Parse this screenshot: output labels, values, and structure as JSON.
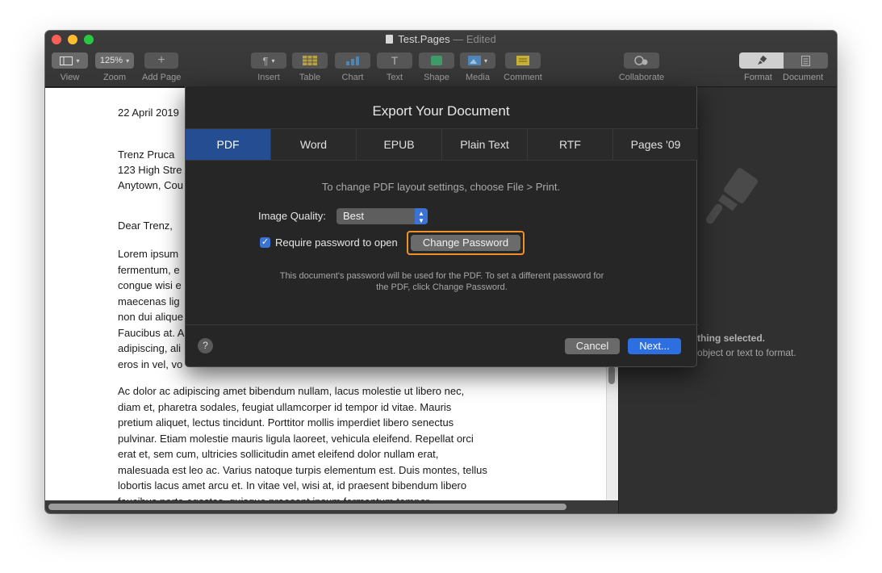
{
  "window": {
    "title": "Test.Pages",
    "status": "— Edited"
  },
  "toolbar": {
    "view_label": "View",
    "zoom_value": "125%",
    "zoom_label": "Zoom",
    "add_page_label": "Add Page",
    "insert_label": "Insert",
    "table_label": "Table",
    "chart_label": "Chart",
    "text_label": "Text",
    "shape_label": "Shape",
    "media_label": "Media",
    "comment_label": "Comment",
    "collaborate_label": "Collaborate",
    "format_label": "Format",
    "document_label": "Document"
  },
  "document": {
    "date": "22 April 2019",
    "address_lines": [
      "Trenz Pruca",
      "123 High Stre",
      "Anytown, Cou"
    ],
    "greeting": "Dear Trenz,",
    "para1": [
      "Lorem ipsum",
      "fermentum, e",
      "congue wisi e",
      "maecenas lig",
      "non dui alique",
      "Faucibus at. A",
      "adipiscing, ali",
      "eros in vel, vo"
    ],
    "para2": [
      "Ac dolor ac adipiscing amet bibendum nullam, lacus molestie ut libero nec,",
      "diam et, pharetra sodales, feugiat ullamcorper id tempor id vitae. Mauris",
      "pretium aliquet, lectus tincidunt. Porttitor mollis imperdiet libero senectus",
      "pulvinar. Etiam molestie mauris ligula laoreet, vehicula eleifend. Repellat orci",
      "erat et, sem cum, ultricies sollicitudin amet eleifend dolor nullam erat,",
      "malesuada est leo ac. Varius natoque turpis elementum est. Duis montes, tellus",
      "lobortis lacus amet arcu et. In vitae vel, wisi at, id praesent bibendum libero",
      "faucibus porta egestas, quisque praesent ipsum fermentum tempor."
    ]
  },
  "inspector": {
    "line1": "thing selected.",
    "line2": "object or text to format."
  },
  "dialog": {
    "title": "Export Your Document",
    "tabs": [
      "PDF",
      "Word",
      "EPUB",
      "Plain Text",
      "RTF",
      "Pages '09"
    ],
    "active_tab": "PDF",
    "hint": "To change PDF layout settings, choose File > Print.",
    "image_quality_label": "Image Quality:",
    "image_quality_value": "Best",
    "require_password_label": "Require password to open",
    "require_password_checked": true,
    "change_password_label": "Change Password",
    "note_line1": "This document's password will be used for the PDF. To set a different password for",
    "note_line2": "the PDF, click Change Password.",
    "help_label": "?",
    "cancel_label": "Cancel",
    "next_label": "Next..."
  },
  "colors": {
    "accent": "#2d6fe0",
    "active_tab": "#244d92",
    "focus_ring": "#f0902c"
  }
}
